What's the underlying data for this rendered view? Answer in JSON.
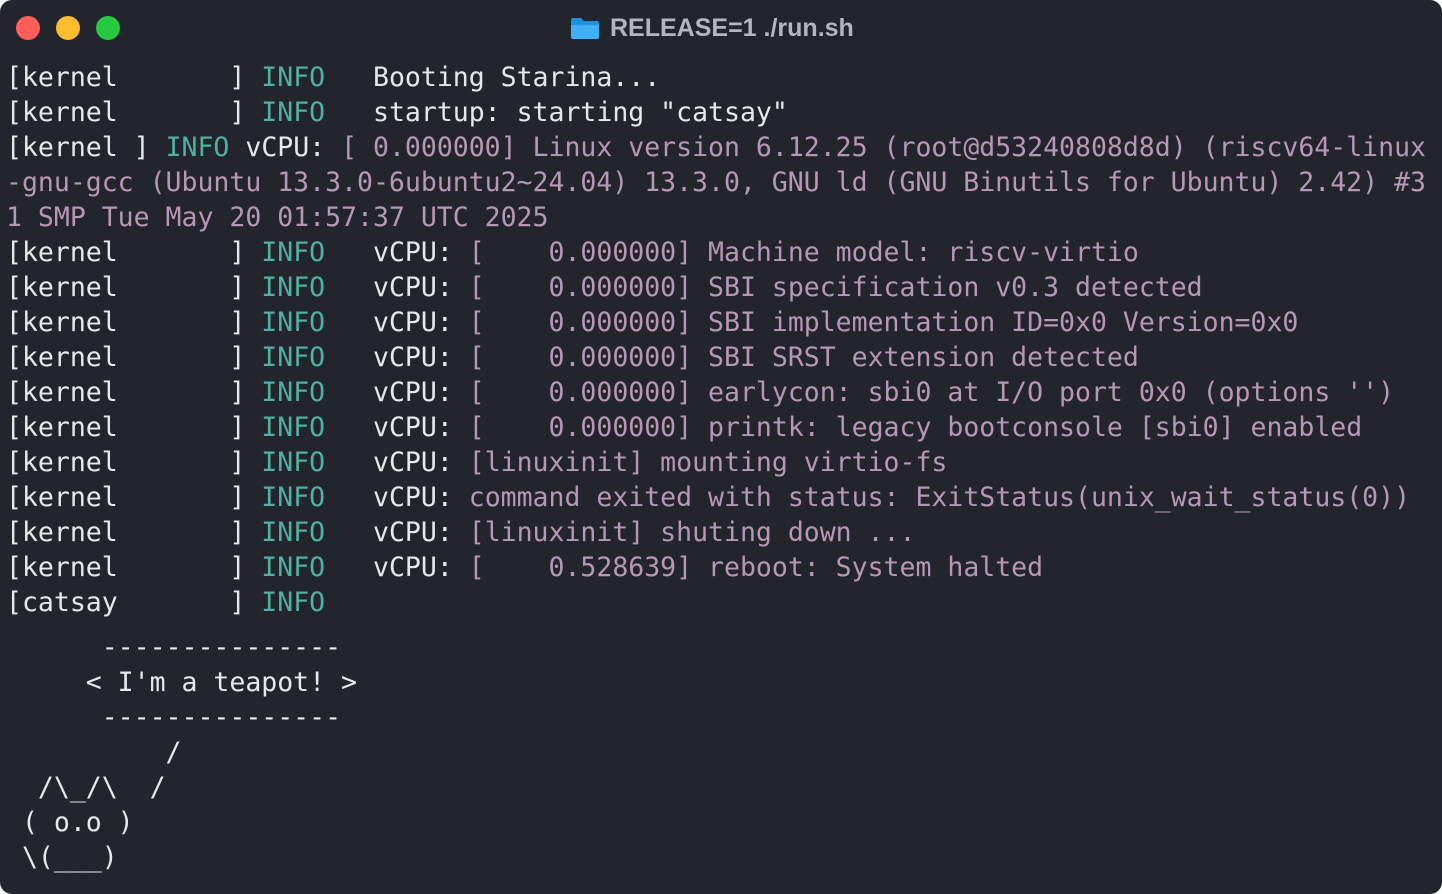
{
  "window": {
    "title": "RELEASE=1 ./run.sh",
    "title_icon": "folder-icon",
    "traffic_lights": {
      "close": "#fe5f57",
      "minimize": "#febc2e",
      "maximize": "#28c840"
    }
  },
  "colors": {
    "background": "#23252c",
    "info": "#4fb0a3",
    "vcpu_output": "#b896b6",
    "text": "#e8e8ea"
  },
  "lines": [
    {
      "source": "[kernel       ]",
      "level": "INFO",
      "message": "Booting Starina...",
      "output": ""
    },
    {
      "source": "[kernel       ]",
      "level": "INFO",
      "message": "startup: starting \"catsay\"",
      "output": ""
    },
    {
      "source": "[kernel       ]",
      "level": "INFO",
      "message": "vCPU: ",
      "output": "[    0.000000] Linux version 6.12.25 (root@d53240808d8d) (riscv64-linux-gnu-gcc (Ubuntu 13.3.0-6ubuntu2~24.04) 13.3.0, GNU ld (GNU Binutils for Ubuntu) 2.42) #31 SMP Tue May 20 01:57:37 UTC 2025"
    },
    {
      "source": "[kernel       ]",
      "level": "INFO",
      "message": "vCPU: ",
      "output": "[    0.000000] Machine model: riscv-virtio"
    },
    {
      "source": "[kernel       ]",
      "level": "INFO",
      "message": "vCPU: ",
      "output": "[    0.000000] SBI specification v0.3 detected"
    },
    {
      "source": "[kernel       ]",
      "level": "INFO",
      "message": "vCPU: ",
      "output": "[    0.000000] SBI implementation ID=0x0 Version=0x0"
    },
    {
      "source": "[kernel       ]",
      "level": "INFO",
      "message": "vCPU: ",
      "output": "[    0.000000] SBI SRST extension detected"
    },
    {
      "source": "[kernel       ]",
      "level": "INFO",
      "message": "vCPU: ",
      "output": "[    0.000000] earlycon: sbi0 at I/O port 0x0 (options '')"
    },
    {
      "source": "[kernel       ]",
      "level": "INFO",
      "message": "vCPU: ",
      "output": "[    0.000000] printk: legacy bootconsole [sbi0] enabled"
    },
    {
      "source": "[kernel       ]",
      "level": "INFO",
      "message": "vCPU: ",
      "output": "[linuxinit] mounting virtio-fs"
    },
    {
      "source": "[kernel       ]",
      "level": "INFO",
      "message": "vCPU: ",
      "output": "command exited with status: ExitStatus(unix_wait_status(0))"
    },
    {
      "source": "[kernel       ]",
      "level": "INFO",
      "message": "vCPU: ",
      "output": "[linuxinit] shuting down ..."
    },
    {
      "source": "[kernel       ]",
      "level": "INFO",
      "message": "vCPU: ",
      "output": "[    0.528639] reboot: System halted"
    },
    {
      "source": "[catsay       ]",
      "level": "INFO",
      "message": "",
      "output": ""
    }
  ],
  "catsay_art": [
    "      ---------------",
    "     < I'm a teapot! >",
    "      ---------------",
    "          /",
    "  /\\_/\\  /",
    " ( o.o )",
    " \\(___)"
  ]
}
